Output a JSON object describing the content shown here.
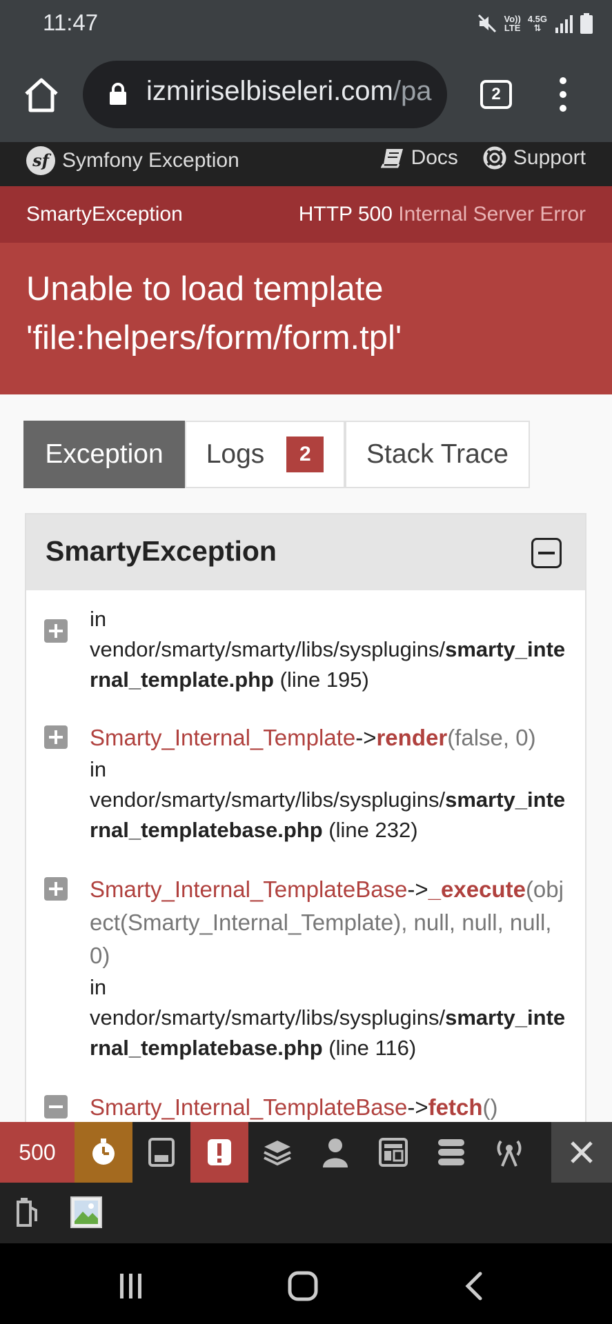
{
  "status_bar": {
    "time": "11:47",
    "icons": [
      "mute-icon",
      "volte-icon",
      "4g-icon",
      "signal-icon",
      "battery-icon"
    ],
    "volte_label_top": "Vo))",
    "volte_label_bottom": "LTE",
    "network_label": "4.5G"
  },
  "browser": {
    "url_main": "izmiriselbiseleri.com",
    "url_faded": "/pa",
    "tab_count": "2"
  },
  "symfony_header": {
    "brand": "Symfony Exception",
    "docs_label": "Docs",
    "support_label": "Support"
  },
  "exception": {
    "class": "SmartyException",
    "http_code": "HTTP 500",
    "http_text": "Internal Server Error",
    "message": "Unable to load template 'file:helpers/form/form.tpl'"
  },
  "tabs": {
    "exception": "Exception",
    "logs": "Logs",
    "logs_count": "2",
    "stack_trace": "Stack Trace"
  },
  "trace": {
    "title": "SmartyException",
    "items": [
      {
        "in": "in",
        "path": "vendor/smarty/smarty/libs/sysplugins/",
        "file": "smarty_internal_template.php",
        "line": "(line 195)"
      },
      {
        "class": "Smarty_Internal_Template",
        "arrow": "->",
        "function": "render",
        "args": "(false, 0)",
        "in": "in",
        "path": "vendor/smarty/smarty/libs/sysplugins/",
        "file": "smarty_internal_templatebase.php",
        "line": "(line 232)"
      },
      {
        "class": "Smarty_Internal_TemplateBase",
        "arrow": "->",
        "function": "_execute",
        "args": "(object(Smarty_Internal_Template), null, null, null, 0)",
        "in": "in",
        "path": "vendor/smarty/smarty/libs/sysplugins/",
        "file": "smarty_internal_templatebase.php",
        "line": "(line 116)"
      },
      {
        "class": "Smarty_Internal_TemplateBase",
        "arrow": "->",
        "function": "fetch",
        "args": "()"
      }
    ]
  },
  "debug_toolbar": {
    "status_code": "500",
    "icons": [
      "time-icon",
      "memory-icon",
      "exception-icon",
      "layers-icon",
      "user-icon",
      "template-icon",
      "db-icon",
      "events-icon",
      "close-icon",
      "phpinfo-icon",
      "broken-image-icon"
    ]
  },
  "colors": {
    "exception_red": "#b0413e",
    "header_dark": "#222222",
    "chrome_gray": "#3c4043"
  }
}
